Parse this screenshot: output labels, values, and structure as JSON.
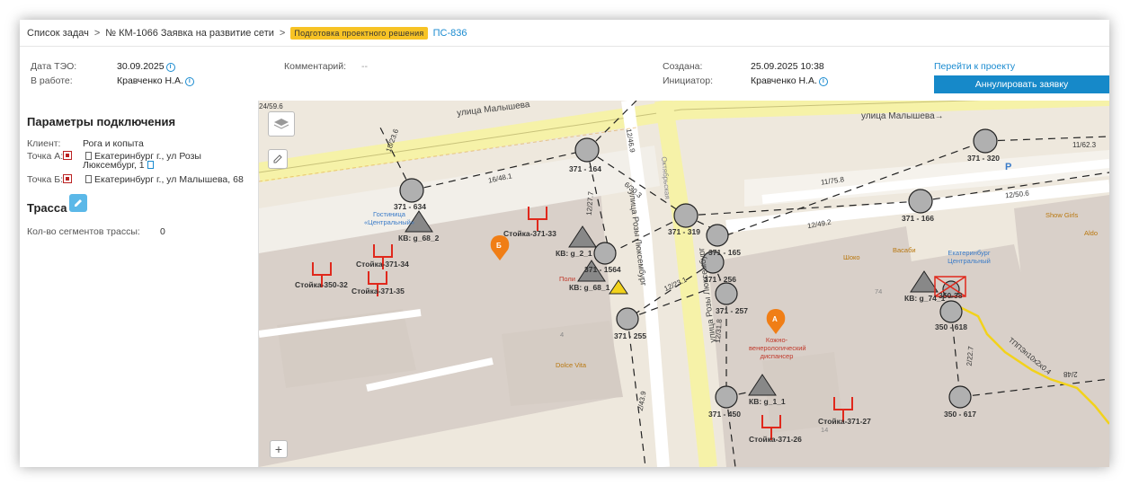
{
  "breadcrumb": {
    "task_list": "Список задач",
    "separator": ">",
    "request": "№ КМ-1066 Заявка на развитие сети",
    "stage": "Подготовка проектного решения",
    "id": "ПС-836"
  },
  "header": {
    "date_label": "Дата ТЭО:",
    "date_value": "30.09.2025",
    "work_label": "В работе:",
    "work_value": "Кравченко Н.А.",
    "comment_label": "Комментарий:",
    "comment_value": "--",
    "created_label": "Создана:",
    "created_value": "25.09.2025 10:38",
    "initiator_label": "Инициатор:",
    "initiator_value": "Кравченко Н.А.",
    "project_link": "Перейти к проекту",
    "cancel_button": "Аннулировать заявку",
    "info_icon": "i"
  },
  "params": {
    "title": "Параметры подключения",
    "client_label": "Клиент:",
    "client_value": "Рога и копыта",
    "point_a_label": "Точка А:",
    "point_a_line1": "Екатеринбург г., ул Розы",
    "point_a_line2": "Люксембург, 1",
    "point_b_label": "Точка Б:",
    "point_b_value": "Екатеринбург г., ул Малышева, 68",
    "route_title": "Трасса",
    "segments_label": "Кол-во сегментов трассы:",
    "segments_value": "0"
  },
  "map": {
    "streets": [
      "улица Малышева",
      "улица Малышева→",
      "улица Розы Люксембург",
      "улица Розы Люксембург",
      "Октябрьская"
    ],
    "circle_labels": [
      "371 - 634",
      "371 - 164",
      "371 - 319",
      "371 - 165",
      "371 - 1564",
      "371 - 256",
      "371 - 257",
      "371 - 255",
      "371 - 450",
      "371 - 320",
      "371 - 166",
      "350 - 618",
      "350 - 617",
      "350-38"
    ],
    "triangle_labels": [
      "КВ: g_68_2",
      "КВ: g_2_1",
      "КВ: g_68_1",
      "КВ: g_74_1",
      "КВ: g_1_1"
    ],
    "pole_labels": [
      "Стойка-371-33",
      "Стойка-371-34",
      "Стойка-350-32",
      "Стойка-371-35",
      "Стойка-371-27",
      "Стойка-371-26"
    ],
    "segment_labels": [
      "18/23.6",
      "16/48.1",
      "12/46.9",
      "6/30.3",
      "12/27.7",
      "12/23.1",
      "11/75.8",
      "12/49.2",
      "12/50.6",
      "11/62.3",
      "2/22.7",
      "2/43.9",
      "12/31.8",
      "ТППЭп10х2х0.4",
      "2/48"
    ],
    "pois": [
      "Гостиница «Центральный»",
      "Кожно-венерологический диспансер",
      "Екатеринбург Центральный",
      "Шоко",
      "Васаби",
      "Show Girls",
      "Aldo",
      "Dolce Vita",
      "Поли",
      "P",
      "74",
      "14",
      "4"
    ],
    "marker_a": "А",
    "marker_b": "Б",
    "zoom_in": "+",
    "partial_label": "24/59.6",
    "colors": {
      "pole": "#e0281c",
      "route": "#f2d21b",
      "marker": "#f07e16",
      "accent": "#1689c9",
      "badge": "#f7c325"
    }
  }
}
